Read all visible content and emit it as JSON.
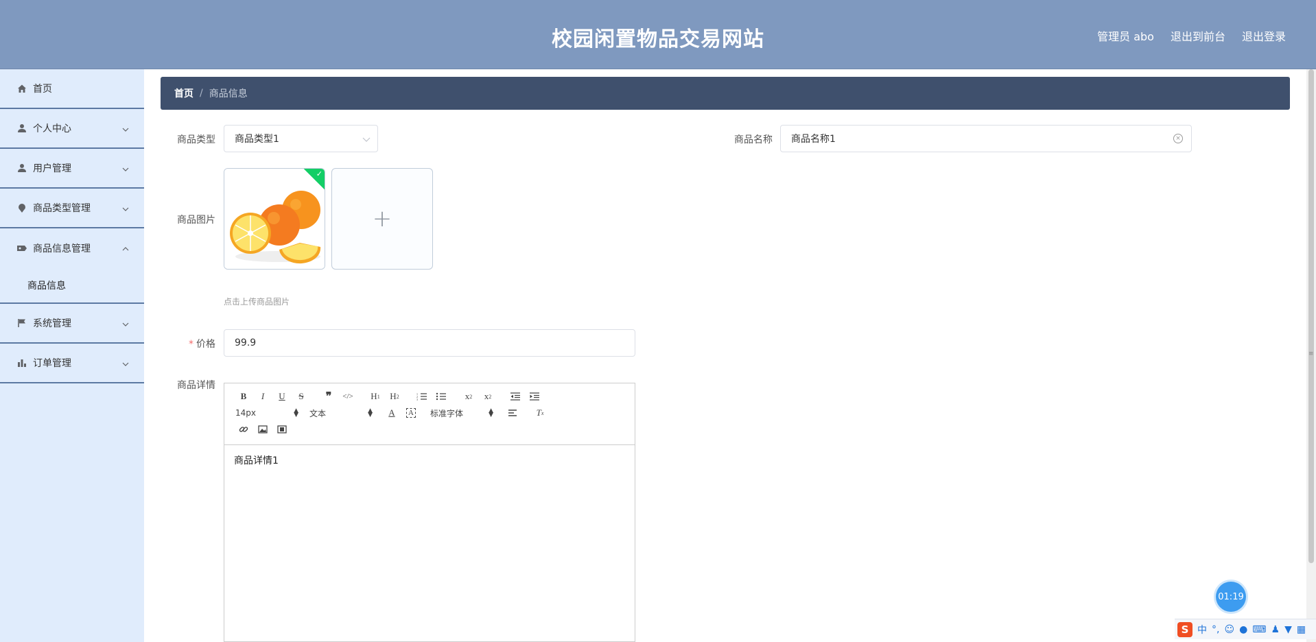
{
  "header": {
    "title": "校园闲置物品交易网站",
    "admin_label": "管理员 abo",
    "to_front_label": "退出到前台",
    "logout_label": "退出登录"
  },
  "sidebar": {
    "items": [
      {
        "label": "首页",
        "icon": "home-icon"
      },
      {
        "label": "个人中心",
        "icon": "user-icon"
      },
      {
        "label": "用户管理",
        "icon": "user-icon"
      },
      {
        "label": "商品类型管理",
        "icon": "pin-icon"
      },
      {
        "label": "商品信息管理",
        "icon": "ticket-icon"
      },
      {
        "label": "系统管理",
        "icon": "flag-icon"
      },
      {
        "label": "订单管理",
        "icon": "bar-chart-icon"
      }
    ],
    "submenu": {
      "label": "商品信息"
    }
  },
  "breadcrumb": {
    "home": "首页",
    "separator": "/",
    "current": "商品信息"
  },
  "form": {
    "type_label": "商品类型",
    "type_value": "商品类型1",
    "name_label": "商品名称",
    "name_value": "商品名称1",
    "image_label": "商品图片",
    "upload_hint": "点击上传商品图片",
    "price_required_mark": "*",
    "price_label": "价格",
    "price_value": "99.9",
    "detail_label": "商品详情"
  },
  "editor": {
    "font_size": "14px",
    "header_select": "文本",
    "font_family": "标准字体",
    "content": "商品详情1"
  },
  "overlay": {
    "timer": "01:19",
    "ime_lang": "中"
  },
  "colors": {
    "header_bg": "#7f99bf",
    "sidebar_bg": "#e0ecfc",
    "breadcrumb_bg": "#3f506d",
    "required": "#f56c6c",
    "success": "#13ce66"
  }
}
